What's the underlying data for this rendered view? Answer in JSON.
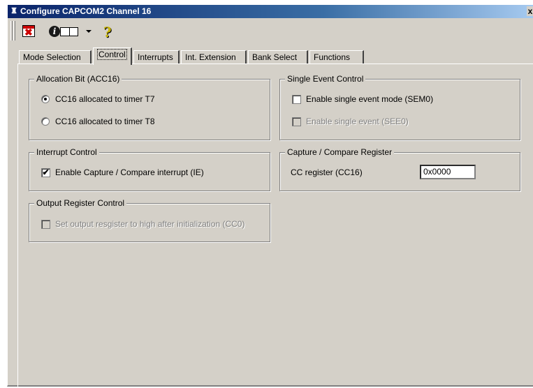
{
  "window": {
    "title": "Configure CAPCOM2 Channel 16",
    "close_glyph": "x"
  },
  "toolbar": {
    "close_icon_glyph": "✖",
    "info_icon_glyph": "i",
    "help_icon_glyph": "?"
  },
  "tabs": [
    {
      "label": "Mode Selection"
    },
    {
      "label": "Control"
    },
    {
      "label": "Interrupts"
    },
    {
      "label": "Int. Extension"
    },
    {
      "label": "Bank Select"
    },
    {
      "label": "Functions"
    }
  ],
  "allocation": {
    "legend": "Allocation Bit (ACC16)",
    "options": [
      {
        "label": "CC16 allocated to timer T7",
        "selected": true
      },
      {
        "label": "CC16 allocated to timer T8",
        "selected": false
      }
    ]
  },
  "single_event": {
    "legend": "Single Event Control",
    "enable_mode_label": "Enable single event mode (SEM0)",
    "enable_event_label": "Enable single event (SEE0)"
  },
  "interrupt_control": {
    "legend": "Interrupt Control",
    "enable_label": "Enable Capture / Compare interrupt (IE)",
    "check_glyph": "✔"
  },
  "ccr": {
    "legend": "Capture / Compare Register",
    "register_label": "CC register (CC16)",
    "register_value": "0x0000"
  },
  "output_register": {
    "legend": "Output Register Control",
    "set_output_label": "Set output resgister to high after initialization (CC0)"
  }
}
